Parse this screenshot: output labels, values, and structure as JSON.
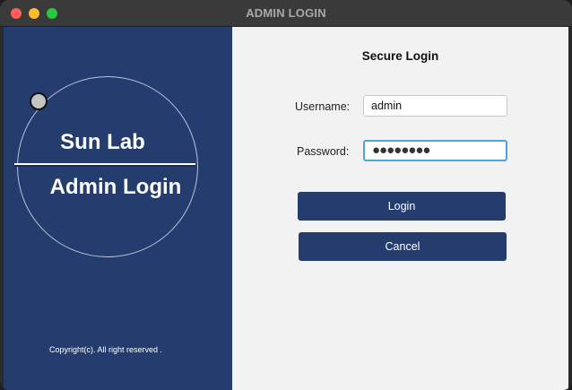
{
  "window": {
    "title": "ADMIN LOGIN",
    "controls": [
      "close",
      "minimize",
      "zoom"
    ]
  },
  "brand": {
    "line1": "Sun Lab",
    "line2": "Admin Login",
    "copyright": "Copyright(c). All right reserved ."
  },
  "form": {
    "heading": "Secure Login",
    "username_label": "Username:",
    "username_value": "admin",
    "password_label": "Password:",
    "password_masked": "●●●●●●●●",
    "login_label": "Login",
    "cancel_label": "Cancel"
  },
  "colors": {
    "panel_blue": "#243d6e",
    "background": "#f2f2f2",
    "focus_ring": "#4aa7d8"
  }
}
